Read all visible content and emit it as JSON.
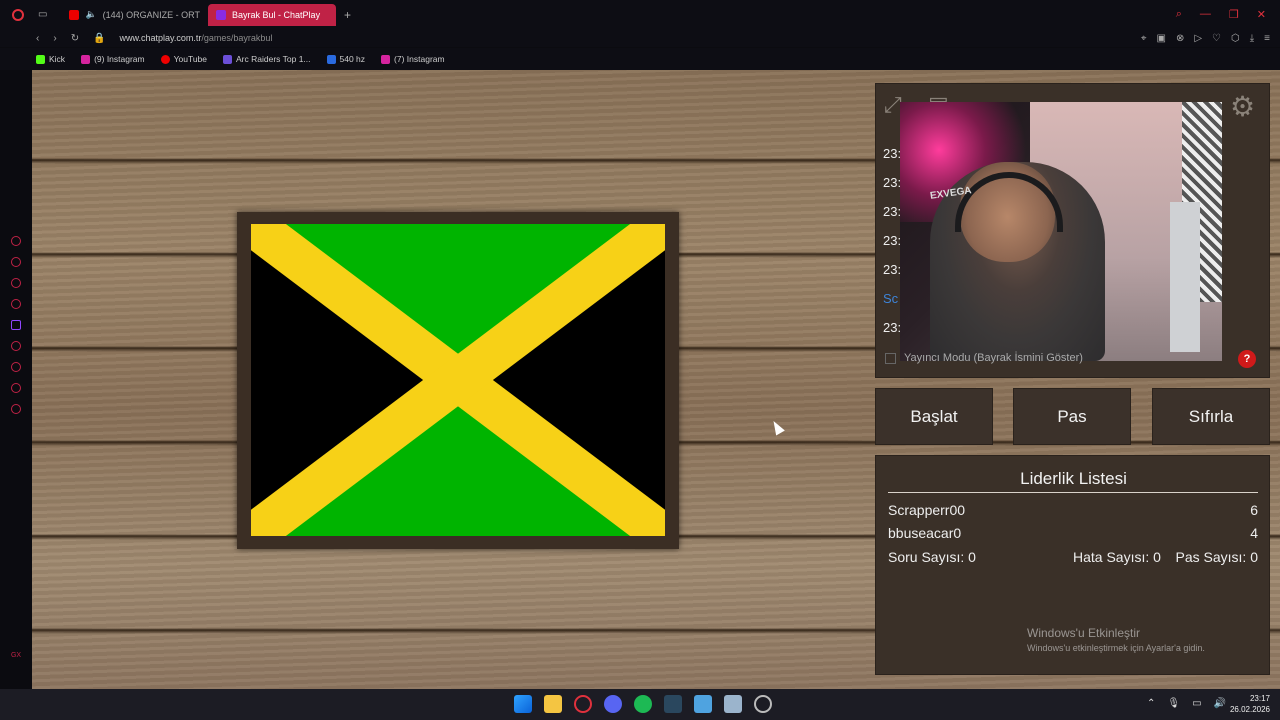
{
  "browser": {
    "tabs": [
      {
        "label": "(144) ORGANIZE - ORT",
        "active": false
      },
      {
        "label": "Bayrak Bul - ChatPlay",
        "active": true
      }
    ],
    "url_host": "www.chatplay.com.tr",
    "url_path": "/games/bayrakbul",
    "bookmarks": [
      "Kick",
      "(9) Instagram",
      "YouTube",
      "Arc Raiders Top 1...",
      "540 hz",
      "(7) Instagram"
    ]
  },
  "chat": {
    "times": [
      "23:",
      "23:",
      "23:",
      "23:",
      "23:",
      "Sc",
      "23:"
    ],
    "mode_label": "Yayıncı Modu (Bayrak İsmini Göster)"
  },
  "flag": {
    "name_icon": "jamaica-flag",
    "colors": {
      "green": "#00b400",
      "gold": "#f7d117",
      "black": "#000000"
    }
  },
  "controls": {
    "start": "Başlat",
    "pass": "Pas",
    "reset": "Sıfırla"
  },
  "leaderboard": {
    "title": "Liderlik Listesi",
    "rows": [
      {
        "name": "Scrapperr00",
        "score": "6"
      },
      {
        "name": "bbuseacar0",
        "score": "4"
      }
    ],
    "stats": {
      "questions": "Soru Sayısı: 0",
      "errors": "Hata Sayısı: 0",
      "passes": "Pas Sayısı: 0"
    }
  },
  "watermark": {
    "line1": "Windows'u Etkinleştir",
    "line2": "Windows'u etkinleştirmek için Ayarlar'a gidin."
  },
  "webcam": {
    "overlay_text": "EXVEGA"
  },
  "taskbar": {
    "time": "23:17",
    "date": "26.02.2026"
  }
}
